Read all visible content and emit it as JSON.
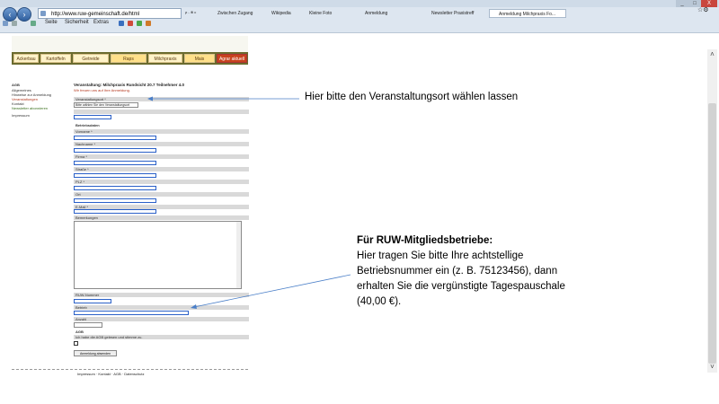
{
  "browser": {
    "address": "http://www.ruw-gemeinschaft.de/html",
    "search_hint": "ρ - ⊗ c",
    "tabs": [
      {
        "label": "Zwischen Zugang"
      },
      {
        "label": "Wikipedia"
      },
      {
        "label": "Kleine Foto"
      },
      {
        "label": "Anmeldung"
      },
      {
        "label": "Newsletter Praxistreff"
      },
      {
        "label": "Anmeldung Milchpraxis Fo..."
      }
    ],
    "menu": [
      "Seite",
      "Sicherheit",
      "Extras"
    ],
    "win_close": "X"
  },
  "page": {
    "banner_tabs": [
      "Ackerbau",
      "Kartoffeln",
      "Getreide",
      "Raps",
      "Milchpraxis",
      "Mais",
      "Agrar aktuell"
    ],
    "left_col": [
      "AGB",
      "Allgemeines",
      "Hinweise zur Anmeldung",
      "Veranstaltungen",
      "Kontakt",
      "Newsletter abonnieren",
      "Impressum"
    ],
    "heading": "Veranstaltung: Milchpraxis   Rundsicht 20.7   Teilnehmer 4.0",
    "subheading": "Wir freuen uns auf Ihre Anmeldung.",
    "venue_label": "Bitte wählen Sie den Veranstaltungsort",
    "sections": {
      "veranstaltungsort": "Veranstaltungsort *",
      "betriebsdaten": "Betriebsdaten",
      "vorname": "Vorname *",
      "nachname": "Nachname *",
      "firma": "Firma *",
      "strasse": "Straße *",
      "plz": "PLZ *",
      "ort": "Ort",
      "email": "E-Mail *",
      "bemerkungen": "Bemerkungen",
      "ruw_nummer": "RUW-Nummer",
      "betrieb": "Betrieb",
      "anzahl": "Anzahl",
      "agb": "AGB",
      "agb_text": "Ich habe die AGB gelesen und stimme zu.",
      "submit": "Anmeldung absenden"
    },
    "footer": "Impressum · Kontakt · AGB · Datenschutz"
  },
  "annotations": {
    "venue_note": "Hier bitte den Veranstaltungsort wählen lassen",
    "ruw_title": "Für RUW-Mitgliedsbetriebe:",
    "ruw_lines": [
      "Hier tragen Sie bitte Ihre achtstellige",
      "Betriebsnummer ein (z. B. 75123456), dann",
      "erhalten Sie die vergünstigte Tagespauschale",
      "(40,00 €)."
    ]
  },
  "colors": {
    "field_border": "#2a60c8",
    "annotation_line": "#4a7fc8",
    "banner": "#6b6b2e",
    "chrome": "#dde6f0"
  }
}
